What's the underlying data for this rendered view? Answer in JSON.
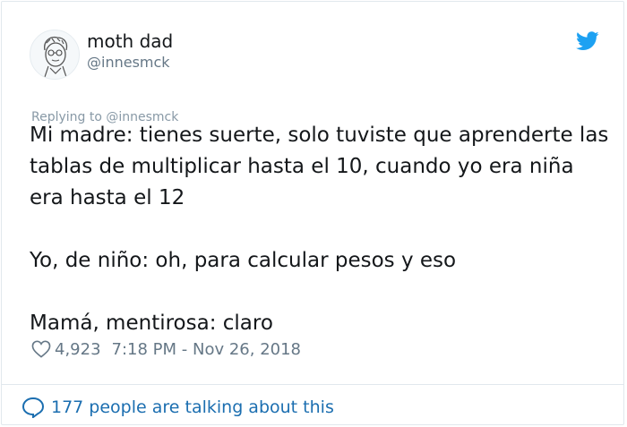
{
  "user": {
    "name": "moth dad",
    "handle": "@innesmck"
  },
  "tweet": {
    "replying_to": "Replying to @innesmck",
    "paragraphs": [
      "Mi madre: tienes suerte, solo tuviste que aprenderte las tablas de multiplicar hasta el 10, cuando yo era niña era hasta el 12",
      "Yo, de niño: oh, para calcular pesos y eso",
      "Mamá, mentirosa: claro"
    ],
    "likes": "4,923",
    "timestamp": "7:18 PM - Nov 26, 2018"
  },
  "footer": {
    "conversation_label": "177 people are talking about this"
  },
  "icons": {
    "brand": "twitter-bird-icon",
    "like": "heart-icon",
    "conversation": "speech-bubble-icon"
  },
  "colors": {
    "twitter_blue": "#1da1f2",
    "link_blue": "#1b6eb0",
    "secondary_text": "#657786"
  }
}
